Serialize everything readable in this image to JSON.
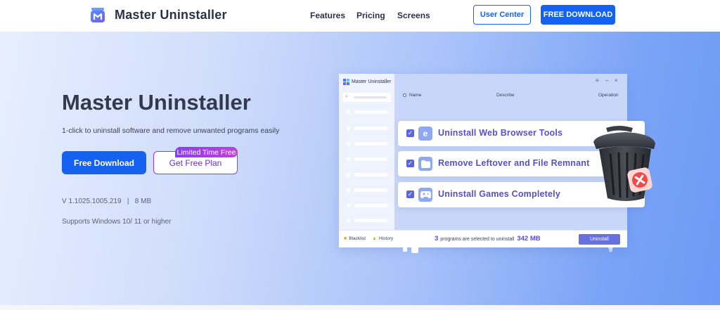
{
  "nav": {
    "brand": "Master Uninstaller",
    "links": [
      "Features",
      "Pricing",
      "Screens"
    ],
    "user_center": "User Center",
    "free_download": "FREE DOWNLOAD"
  },
  "hero": {
    "title": "Master Uninstaller",
    "subtitle": "1-click to uninstall software and remove unwanted programs easily",
    "btn_free_download": "Free Download",
    "btn_free_plan": "Get Free Plan",
    "badge": "Limited Time Free",
    "version": "V 1.1025.1005.219   |   8 MB",
    "supports": "Supports Windows 10/ 11 or higher"
  },
  "app": {
    "title": "Master Uninstaller",
    "columns": {
      "name": "Name",
      "describe": "Describe",
      "operation": "Operation"
    },
    "window_controls": [
      "≡",
      "–",
      "×"
    ],
    "features": [
      {
        "label": "Uninstall Web Browser Tools",
        "icon": "browser-icon",
        "checked": true
      },
      {
        "label": "Remove Leftover and File Remnant",
        "icon": "folder-icon",
        "checked": true
      },
      {
        "label": "Uninstall Games Completely",
        "icon": "gamepad-icon",
        "checked": true
      }
    ],
    "footer": {
      "blacklist": "Blacklist",
      "history": "History",
      "count": "3",
      "count_text": "programs are selected to uninstall",
      "size": "342 MB",
      "uninstall_button": "Uninstall"
    }
  },
  "colors": {
    "primary": "#1662f0",
    "accent_purple": "#8b3cf0",
    "card_text": "#5750c8",
    "uninstall_button": "#6770e0"
  }
}
